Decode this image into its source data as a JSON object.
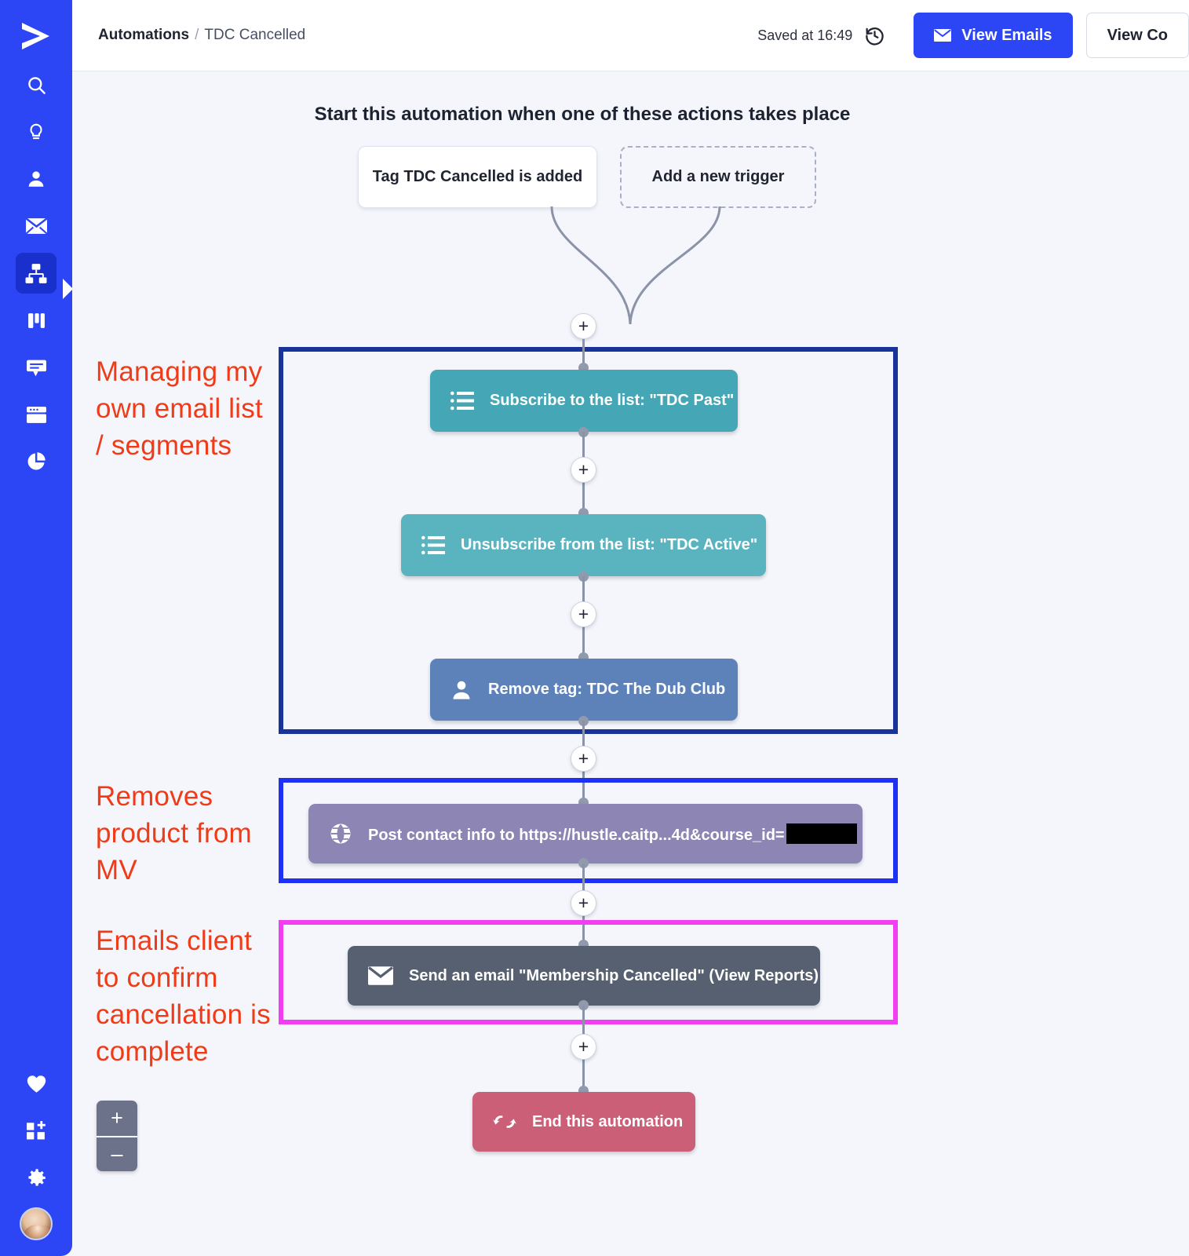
{
  "sidebar": {
    "logo": "activecampaign-logo",
    "items": [
      {
        "name": "search-icon",
        "label": "Search"
      },
      {
        "name": "lightbulb-icon",
        "label": "Ideas"
      },
      {
        "name": "contacts-icon",
        "label": "Contacts"
      },
      {
        "name": "envelope-icon",
        "label": "Campaigns"
      },
      {
        "name": "automations-icon",
        "label": "Automations",
        "active": true
      },
      {
        "name": "deals-icon",
        "label": "Deals"
      },
      {
        "name": "conversations-icon",
        "label": "Conversations"
      },
      {
        "name": "pages-icon",
        "label": "Pages"
      },
      {
        "name": "reports-icon",
        "label": "Reports"
      }
    ],
    "bottom_items": [
      {
        "name": "heart-icon",
        "label": "Favorites"
      },
      {
        "name": "apps-add-icon",
        "label": "Apps"
      },
      {
        "name": "gear-icon",
        "label": "Settings"
      }
    ],
    "avatar": "user-avatar"
  },
  "topbar": {
    "crumb_root": "Automations",
    "crumb_sep": "/",
    "crumb_current": "TDC Cancelled",
    "saved_text": "Saved at 16:49",
    "history_icon": "history-clock-icon",
    "view_emails_label": "View Emails",
    "view_emails_icon": "envelope-icon",
    "view_contacts_label": "View Co"
  },
  "flow": {
    "title": "Start this automation when one of these actions takes place",
    "triggers": [
      {
        "label": "Tag TDC Cancelled is added",
        "style": "solid"
      },
      {
        "label": "Add a new trigger",
        "style": "dashed"
      }
    ],
    "nodes": [
      {
        "id": "subscribe",
        "label": "Subscribe to the list: \"TDC Past\"",
        "icon": "list-icon",
        "color": "#45a6b5"
      },
      {
        "id": "unsubscribe",
        "label": "Unsubscribe from the list: \"TDC Active\"",
        "icon": "list-icon",
        "color": "#5ab4bf"
      },
      {
        "id": "remove-tag",
        "label": "Remove tag: TDC The Dub Club",
        "icon": "contact-icon",
        "color": "#5c82b9"
      },
      {
        "id": "webhook",
        "label": "Post contact info to https://hustle.caitp...4d&course_id=",
        "icon": "globe-icon",
        "color": "#8d85b3",
        "redacted": true
      },
      {
        "id": "send-email",
        "label": "Send an email \"Membership Cancelled\" (View Reports)",
        "icon": "envelope-icon",
        "color": "#566070"
      },
      {
        "id": "end",
        "label": "End this automation",
        "icon": "end-arrows-icon",
        "color": "#cc5f78"
      }
    ],
    "add_step_label": "+"
  },
  "annotations": [
    {
      "id": "ann1",
      "text": "Managing my own email list / segments",
      "color": "#ef3b18"
    },
    {
      "id": "ann2",
      "text": "Removes product from MV",
      "color": "#ef3b18"
    },
    {
      "id": "ann3",
      "text": "Emails client to confirm cancellation is complete",
      "color": "#ef3b18"
    }
  ],
  "highlight_boxes": [
    {
      "id": "hl-navy",
      "color": "#18349a"
    },
    {
      "id": "hl-blue",
      "color": "#1f30f5"
    },
    {
      "id": "hl-magenta",
      "color": "#f23ef2"
    }
  ],
  "zoom_controls": {
    "zoom_in": "+",
    "zoom_out": "–"
  }
}
